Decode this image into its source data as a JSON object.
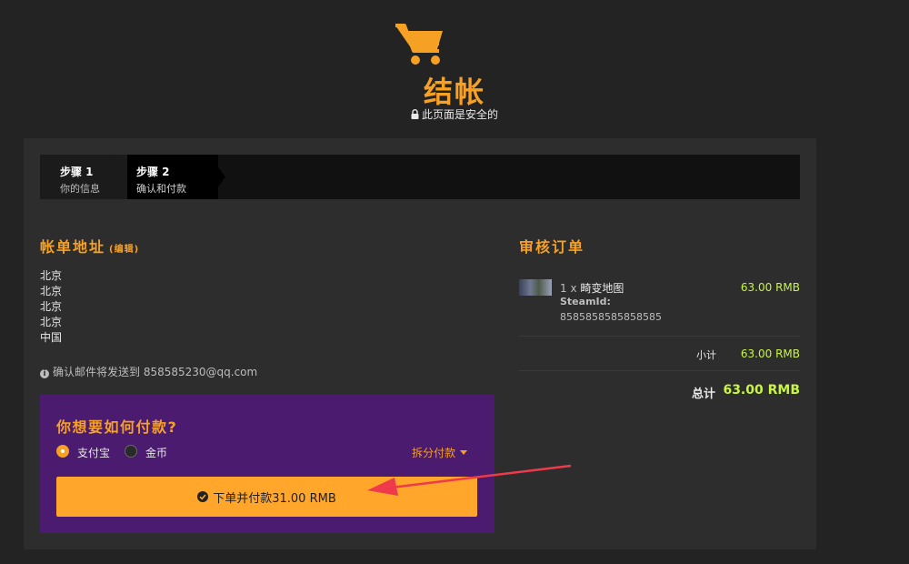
{
  "header": {
    "title": "结帐",
    "secure_note": "此页面是安全的"
  },
  "steps": [
    {
      "number": "步骤 1",
      "label": "你的信息"
    },
    {
      "number": "步骤 2",
      "label": "确认和付款"
    }
  ],
  "billing": {
    "title": "帐单地址",
    "edit_label": "(编辑)",
    "address_lines": [
      "北京",
      "北京",
      "北京",
      "北京",
      "中国"
    ],
    "email_note": "确认邮件将发送到 858585230@qq.com"
  },
  "payment": {
    "title": "你想要如何付款?",
    "options": [
      {
        "label": "支付宝",
        "selected": true
      },
      {
        "label": "金币",
        "selected": false
      }
    ],
    "split_label": "拆分付款",
    "submit_label": "下单并付款31.00 RMB"
  },
  "review": {
    "title": "审核订单",
    "item": {
      "qty": "1 x",
      "name": "畸变地图",
      "steam_label": "SteamId:",
      "steam_id": "8585858585858585",
      "price": "63.00 RMB"
    },
    "subtotal_label": "小计",
    "subtotal_value": "63.00 RMB",
    "total_label": "总计",
    "total_value": "63.00 RMB"
  },
  "colors": {
    "accent": "#f6a024",
    "price": "#c7f542",
    "payment_bg": "#4a1b6e",
    "annotation_arrow": "#ee3a4a"
  }
}
